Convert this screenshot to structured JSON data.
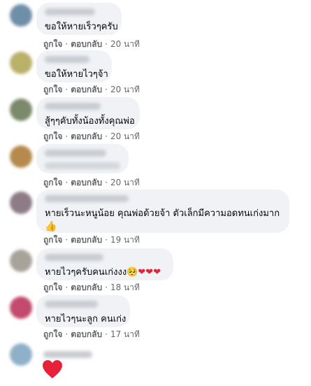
{
  "comments": [
    {
      "text": "ขอให้หายเร็วๆครับ",
      "like": "ถูกใจ",
      "reply": "ตอบกลับ",
      "time": "20 นาที"
    },
    {
      "text": "ขอให้หายไวๆจ้า",
      "like": "ถูกใจ",
      "reply": "ตอบกลับ",
      "time": "20 นาที"
    },
    {
      "text": "สู้ๆๆคับทั้งน้องทั้งคุณพ่อ",
      "like": "ถูกใจ",
      "reply": "ตอบกลับ",
      "time": "20 นาที"
    },
    {
      "text": "",
      "like": "ถูกใจ",
      "reply": "ตอบกลับ",
      "time": "20 นาที"
    },
    {
      "text": "หายเร็วนะหนูน้อย คุณพ่อด้วยจ้า ตัวเล็กมีความอดทนเก่งมาก",
      "like": "ถูกใจ",
      "reply": "ตอบกลับ",
      "time": "19 นาที"
    },
    {
      "text": "หายไวๆครับคนเก่งงง",
      "like": "ถูกใจ",
      "reply": "ตอบกลับ",
      "time": "18 นาที"
    },
    {
      "text": "หายไวๆนะลูก คนเก่ง",
      "like": "ถูกใจ",
      "reply": "ตอบกลับ",
      "time": "17 นาที"
    }
  ],
  "separator": "·",
  "emoji": {
    "thumb": "👍",
    "face": "🥺",
    "heart": "❤"
  },
  "colors": {
    "bubble": "#f0f2f5",
    "meta": "#65676b",
    "heart": "#e8213a"
  }
}
